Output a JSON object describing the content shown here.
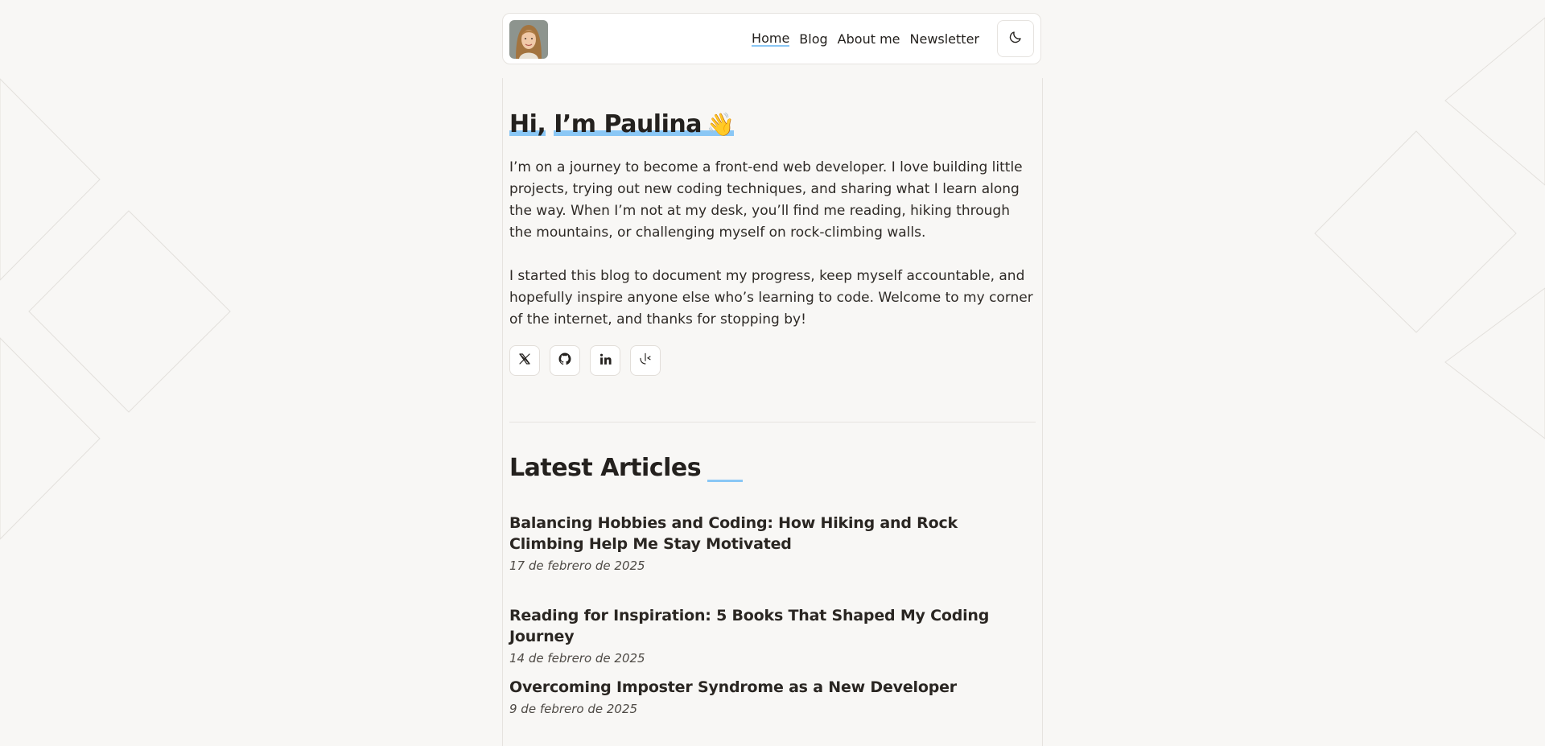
{
  "nav": {
    "links": [
      "Home",
      "Blog",
      "About me",
      "Newsletter"
    ],
    "active": "Home"
  },
  "hero": {
    "title_part1": "Hi,",
    "title_part2": "I’m Paulina",
    "emoji": "👋",
    "bio_paragraphs": [
      "I’m on a journey to become a front-end web developer. I love building little projects, trying out new coding techniques, and sharing what I learn along the way. When I’m not at my desk, you’ll find me reading, hiking through the mountains, or challenging myself on rock-climbing walls.",
      "I started this blog to document my progress, keep myself accountable, and hopefully inspire anyone else who’s learning to code. Welcome to my corner of the internet, and thanks for stopping by!"
    ]
  },
  "socials": [
    {
      "icon": "x-twitter-icon"
    },
    {
      "icon": "github-icon"
    },
    {
      "icon": "linkedin-icon"
    },
    {
      "icon": "frontend-mentor-icon"
    }
  ],
  "articles_section": {
    "title": "Latest Articles",
    "items": [
      {
        "title": "Balancing Hobbies and Coding: How Hiking and Rock Climbing Help Me Stay Motivated",
        "date": "17 de febrero de 2025"
      },
      {
        "title": "Reading for Inspiration: 5 Books That Shaped My Coding Journey",
        "date": "14 de febrero de 2025"
      },
      {
        "title": "Overcoming Imposter Syndrome as a New Developer",
        "date": "9 de febrero de 2025"
      }
    ]
  },
  "colors": {
    "background": "#f8f7f5",
    "accent": "#8ac7f5",
    "text": "#24211e",
    "border": "#e6e3df"
  },
  "icons": {
    "theme_toggle": "moon-icon"
  }
}
